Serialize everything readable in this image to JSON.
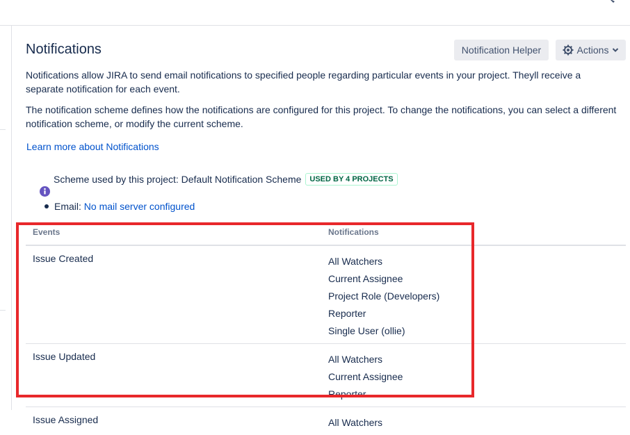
{
  "page": {
    "title": "Notifications",
    "buttons": {
      "helper": "Notification Helper",
      "actions": "Actions"
    },
    "description_1": "Notifications allow JIRA to send email notifications to specified people regarding particular events in your project. Theyll receive a separate notification for each event.",
    "description_2": "The notification scheme defines how the notifications are configured for this project. To change the notifications, you can select a different notification scheme, or modify the current scheme.",
    "learn_more": "Learn more about Notifications"
  },
  "scheme": {
    "label": "Scheme used by this project: Default Notification Scheme",
    "badge": "USED BY 4 PROJECTS"
  },
  "email": {
    "label": "Email:",
    "value": "No mail server configured"
  },
  "table": {
    "headers": {
      "events": "Events",
      "notifications": "Notifications"
    },
    "rows": [
      {
        "event": "Issue Created",
        "notifications": [
          "All Watchers",
          "Current Assignee",
          "Project Role (Developers)",
          "Reporter",
          "Single User (ollie)"
        ]
      },
      {
        "event": "Issue Updated",
        "notifications": [
          "All Watchers",
          "Current Assignee",
          "Reporter"
        ]
      },
      {
        "event": "Issue Assigned",
        "notifications": [
          "All Watchers"
        ]
      }
    ]
  },
  "colors": {
    "link": "#0052cc",
    "highlight_border": "#e8282b",
    "badge_text": "#006644",
    "info_icon": "#6554c0"
  },
  "icons": [
    "gear-icon",
    "chevron-down-icon",
    "info-icon",
    "bullet-icon"
  ]
}
